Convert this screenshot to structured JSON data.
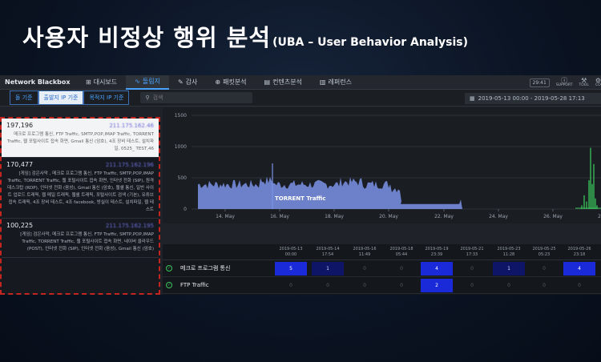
{
  "slide": {
    "title": "사용자 비정상 행위 분석",
    "subtitle": "(UBA – User Behavior Analysis)"
  },
  "nav": {
    "brand": "Network Blackbox",
    "tabs": [
      {
        "label": "대시보드",
        "icon": "dashboard-icon",
        "glyph": "⊞"
      },
      {
        "label": "돌림지",
        "icon": "pulse-icon",
        "glyph": "∿"
      },
      {
        "label": "감사",
        "icon": "edit-icon",
        "glyph": "✎"
      },
      {
        "label": "패킷분석",
        "icon": "target-icon",
        "glyph": "⊕"
      },
      {
        "label": "컨텐츠분석",
        "icon": "document-icon",
        "glyph": "▤"
      },
      {
        "label": "레퍼런스",
        "icon": "book-icon",
        "glyph": "▥"
      }
    ],
    "active_index": 1,
    "clock": "29:41",
    "support": "SUPPORT",
    "tool": "TOOL",
    "config": "CO"
  },
  "filters": {
    "segments": [
      "돌 기준",
      "출발지 IP 기준",
      "목적지 IP 기준"
    ],
    "active_segment": 1,
    "search_placeholder": "검색",
    "date_range": "2019-05-13 00:00 - 2019-05-28 17:13"
  },
  "list": [
    {
      "count": "197,196",
      "ip": "211.175.162.46",
      "desc": "메크로 프로그램 통신, FTP Traffic, SMTP,POP,IMAP Traffic, TORRENT Traffic, 웹 포털사이트 접속 화면, Gmail 통신 (암호), 4조 장비 테스트, 설치파일, 0525_ TEST,46"
    },
    {
      "count": "170,477",
      "ip": "211.175.162.196",
      "desc": "[게임] 검은사막 , 메크로 프로그램 통신, FTP Traffic, SMTP,POP,IMAP Traffic, TORRENT Traffic, 웹 포털사이트 접속 화면, 인터넷 전화 (SIP), 원격 데스크탑 (RDP), 인터넷 전화 (음성), Gmail 통신 (암호), 웹쉘 통신, 일반 사이트 업로드 트래픽, 웹 메일 트래픽, 웹쉘 트래픽, 포털사이트 검색 (기본), 유튜브 접속 트래픽, 4조 장비 테스트, 4조 facebook, 방실이 테스트, 설치파일, 웹 테스트"
    },
    {
      "count": "100,225",
      "ip": "211.175.162.195",
      "desc": "[게임] 검은사막, 메크로 프로그램 통신, FTP Traffic, SMTP,POP,IMAP Traffic, TORRENT Traffic, 웹 포털사이트 접속 화면, 네이버 클라우드 (POST), 인터넷 전화 (SIP), 인터넷 전화 (음성), Gmail 통신 (암호)"
    }
  ],
  "chart_data": {
    "type": "area",
    "y_ticks": [
      "1500",
      "1000",
      "500",
      "0"
    ],
    "ylim": [
      0,
      1500
    ],
    "x_ticks": [
      "14. May",
      "16. May",
      "18. May",
      "20. May",
      "22. May",
      "24. May",
      "26. May",
      "28. May"
    ],
    "series": [
      {
        "name": "TORRENT Traffic",
        "color": "#7b93e8"
      },
      {
        "name": "",
        "color": "#3bc45b"
      }
    ]
  },
  "timeline": {
    "timestamps": [
      [
        "2019-05-13",
        "00:00"
      ],
      [
        "2019-05-14",
        "17:54"
      ],
      [
        "2019-05-16",
        "11:49"
      ],
      [
        "2019-05-18",
        "05:44"
      ],
      [
        "2019-05-19",
        "23:39"
      ],
      [
        "2019-05-21",
        "17:33"
      ],
      [
        "2019-05-23",
        "11:28"
      ],
      [
        "2019-05-25",
        "05:23"
      ],
      [
        "2019-05-26",
        "23:18"
      ]
    ],
    "rows": [
      {
        "name": "메크로 프로그램 통신",
        "values": [
          "5",
          "1",
          "0",
          "0",
          "4",
          "0",
          "1",
          "0",
          "4"
        ]
      },
      {
        "name": "FTP Traffic",
        "values": [
          "0",
          "0",
          "0",
          "0",
          "2",
          "0",
          "0",
          "0",
          "0"
        ]
      }
    ]
  }
}
